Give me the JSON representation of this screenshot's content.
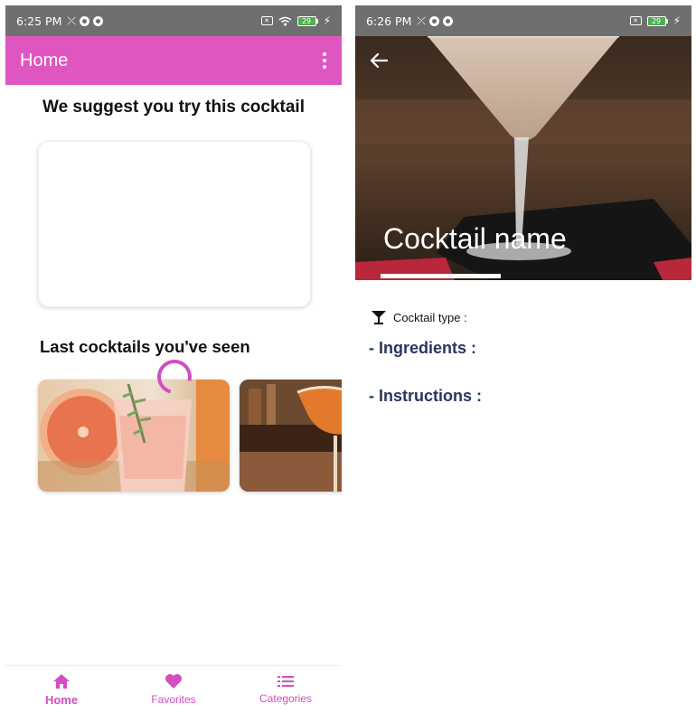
{
  "left_screen": {
    "status_bar": {
      "time": "6:25 PM",
      "battery": "29"
    },
    "app_bar": {
      "title": "Home"
    },
    "suggestion": {
      "heading": "We suggest you try this cocktail"
    },
    "recent": {
      "heading": "Last cocktails you've seen"
    },
    "bottom_nav": {
      "items": [
        {
          "label": "Home",
          "icon": "home-icon",
          "active": true
        },
        {
          "label": "Favorites",
          "icon": "heart-icon",
          "active": false
        },
        {
          "label": "Categories",
          "icon": "list-icon",
          "active": false
        }
      ]
    }
  },
  "right_screen": {
    "status_bar": {
      "time": "6:26 PM",
      "battery": "29"
    },
    "hero": {
      "title": "Cocktail name"
    },
    "details": {
      "type_label": "Cocktail type :",
      "ingredients_heading": "- Ingredients :",
      "instructions_heading": "- Instructions :"
    }
  },
  "colors": {
    "accent": "#e056c1",
    "nav_active": "#d24fbf",
    "section_title": "#2b3560",
    "status_bar": "#6f6f6f"
  }
}
